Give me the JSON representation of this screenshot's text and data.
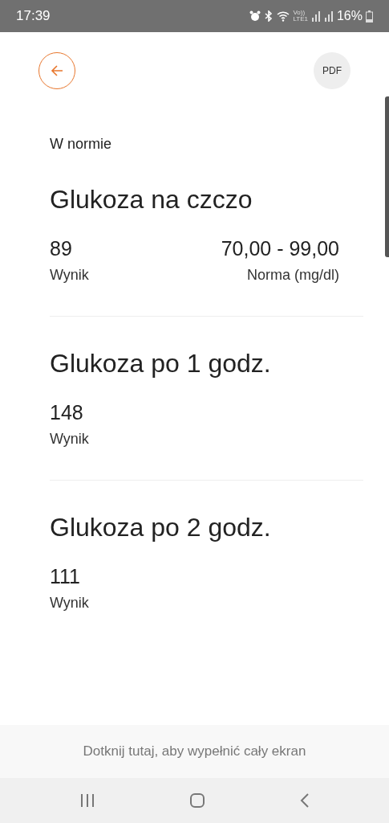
{
  "status_bar": {
    "time": "17:39",
    "network": [
      "Vo))",
      "LTE1"
    ],
    "battery": "16%"
  },
  "header": {
    "pdf_label": "PDF"
  },
  "status_label": "W normie",
  "results": [
    {
      "title": "Glukoza na czczo",
      "value": "89",
      "value_label": "Wynik",
      "norm": "70,00 - 99,00",
      "norm_label": "Norma (mg/dl)"
    },
    {
      "title": "Glukoza po 1 godz.",
      "value": "148",
      "value_label": "Wynik"
    },
    {
      "title": "Glukoza po 2 godz.",
      "value": "111",
      "value_label": "Wynik"
    }
  ],
  "fullscreen_hint": "Dotknij tutaj, aby wypełnić cały ekran"
}
